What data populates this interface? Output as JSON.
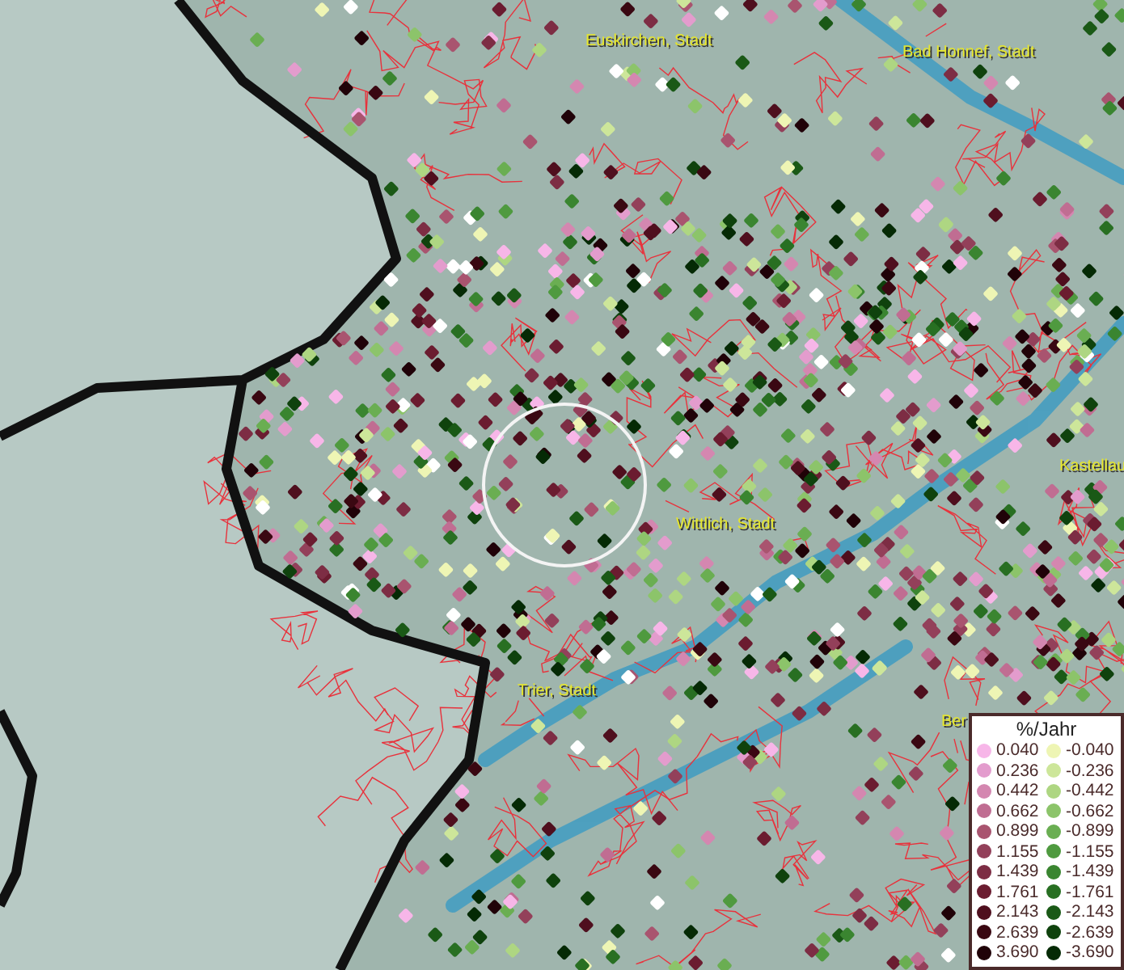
{
  "map": {
    "place_labels": [
      {
        "text": "Euskirchen, Stadt",
        "kind": "city"
      },
      {
        "text": "Bad Honnef, Stadt",
        "kind": "city"
      },
      {
        "text": "Kastellau",
        "kind": "city"
      },
      {
        "text": "Wittlich, Stadt",
        "kind": "city"
      },
      {
        "text": "Trier, Stadt",
        "kind": "city"
      },
      {
        "text": "Ber",
        "kind": "city"
      }
    ]
  },
  "legend": {
    "title": "%/Jahr",
    "positive": [
      {
        "label": "0.040",
        "color": "#f7b6e8"
      },
      {
        "label": "0.236",
        "color": "#e39ccd"
      },
      {
        "label": "0.442",
        "color": "#d487b0"
      },
      {
        "label": "0.662",
        "color": "#c06d92"
      },
      {
        "label": "0.899",
        "color": "#a9546f"
      },
      {
        "label": "1.155",
        "color": "#93405a"
      },
      {
        "label": "1.439",
        "color": "#7d2d44"
      },
      {
        "label": "1.761",
        "color": "#6b1c30"
      },
      {
        "label": "2.143",
        "color": "#4f0f1e"
      },
      {
        "label": "2.639",
        "color": "#3a0812"
      },
      {
        "label": "3.690",
        "color": "#200208"
      }
    ],
    "negative": [
      {
        "label": "-0.040",
        "color": "#eef5b4"
      },
      {
        "label": "-0.236",
        "color": "#cde69a"
      },
      {
        "label": "-0.442",
        "color": "#aed682"
      },
      {
        "label": "-0.662",
        "color": "#8cc46a"
      },
      {
        "label": "-0.899",
        "color": "#6aae52"
      },
      {
        "label": "-1.155",
        "color": "#4f9a3f"
      },
      {
        "label": "-1.439",
        "color": "#3a8530"
      },
      {
        "label": "-1.761",
        "color": "#286f22"
      },
      {
        "label": "-2.143",
        "color": "#1a5916"
      },
      {
        "label": "-2.639",
        "color": "#0f420d"
      },
      {
        "label": "-3.690",
        "color": "#052a05"
      }
    ]
  }
}
